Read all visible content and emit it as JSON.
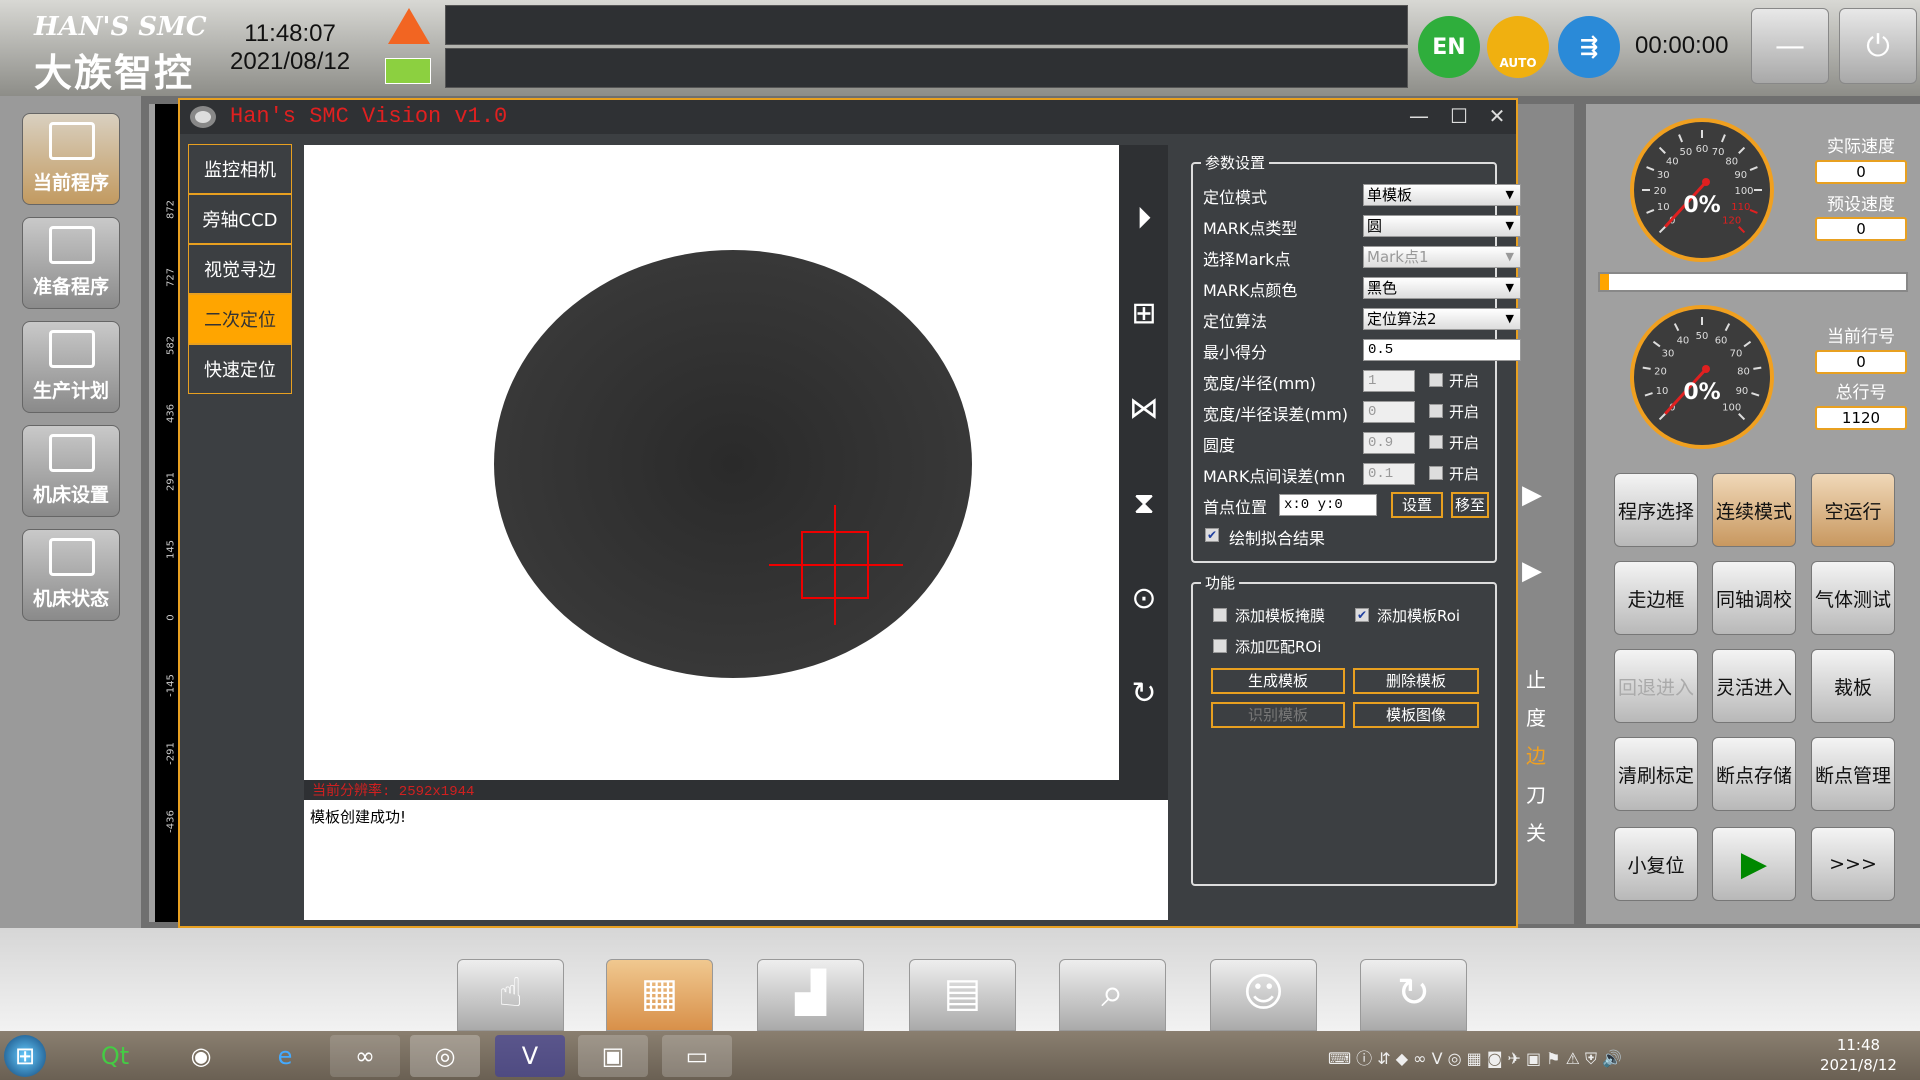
{
  "header": {
    "logo_en": "HAN'S SMC",
    "logo_cn": "大族智控",
    "time": "11:48:07",
    "date": "2021/08/12",
    "lang": "EN",
    "auto": "AUTO",
    "timer": "00:00:00"
  },
  "sidebar": {
    "items": [
      {
        "label": "当前程序",
        "active": true
      },
      {
        "label": "准备程序"
      },
      {
        "label": "生产计划"
      },
      {
        "label": "机床设置"
      },
      {
        "label": "机床状态"
      }
    ]
  },
  "ruler": {
    "ticks": [
      "872",
      "727",
      "582",
      "436",
      "291",
      "145",
      "0",
      "-145",
      "-291",
      "-436"
    ]
  },
  "vision": {
    "title": "Han's SMC Vision v1.0",
    "tabs": [
      {
        "label": "监控相机"
      },
      {
        "label": "旁轴CCD"
      },
      {
        "label": "视觉寻边"
      },
      {
        "label": "二次定位",
        "active": true
      },
      {
        "label": "快速定位"
      }
    ],
    "status": "当前分辨率: 2592x1944",
    "log": "模板创建成功!",
    "params": {
      "title": "参数设置",
      "mode_label": "定位模式",
      "mode": "单模板",
      "mark_type_label": "MARK点类型",
      "mark_type": "圆",
      "mark_sel_label": "选择Mark点",
      "mark_sel": "Mark点1",
      "mark_color_label": "MARK点颜色",
      "mark_color": "黑色",
      "algo_label": "定位算法",
      "algo": "定位算法2",
      "min_score_label": "最小得分",
      "min_score": "0.5",
      "rows": [
        {
          "label": "宽度/半径(mm)",
          "value": "1",
          "enable": "开启"
        },
        {
          "label": "宽度/半径误差(mm)",
          "value": "0",
          "enable": "开启"
        },
        {
          "label": "圆度",
          "value": "0.9",
          "enable": "开启"
        },
        {
          "label": "MARK点间误差(mn",
          "value": "0.1",
          "enable": "开启"
        }
      ],
      "first_pos_label": "首点位置",
      "first_pos": "x:0 y:0",
      "set": "设置",
      "move": "移至",
      "draw_fit": "绘制拟合结果"
    },
    "func": {
      "title": "功能",
      "add_mask": "添加模板掩膜",
      "add_roi": "添加模板Roi",
      "add_match_roi": "添加匹配ROi",
      "gen": "生成模板",
      "del": "删除模板",
      "recog": "识别模板",
      "image": "模板图像"
    }
  },
  "behind": {
    "texts": [
      "止",
      "度",
      "边",
      "刀",
      "关"
    ]
  },
  "right": {
    "actual_speed_label": "实际速度",
    "actual_speed": "0",
    "preset_speed_label": "预设速度",
    "preset_speed": "0",
    "cur_line_label": "当前行号",
    "cur_line": "0",
    "total_line_label": "总行号",
    "total_line": "1120",
    "gauge1": {
      "value": "0%",
      "ticks": [
        "0",
        "10",
        "20",
        "30",
        "40",
        "50",
        "60",
        "70",
        "80",
        "90",
        "100",
        "110",
        "120"
      ]
    },
    "gauge2": {
      "value": "0%",
      "ticks": [
        "0",
        "10",
        "20",
        "30",
        "40",
        "50",
        "60",
        "70",
        "80",
        "90",
        "100"
      ]
    },
    "progress": 0.03,
    "buttons": [
      [
        "程序选择",
        "连续模式",
        "空运行"
      ],
      [
        "走边框",
        "同轴调校",
        "气体测试"
      ],
      [
        "回退进入",
        "灵活进入",
        "裁板"
      ],
      [
        "清刷标定",
        "断点存储",
        "断点管理"
      ],
      [
        "小复位",
        "▶",
        ">>>"
      ]
    ]
  },
  "taskbar": {
    "time": "11:48",
    "date": "2021/8/12"
  },
  "colors": {
    "accent": "#e8a020",
    "active_tab": "#ffa500",
    "title_red": "#e02020"
  }
}
